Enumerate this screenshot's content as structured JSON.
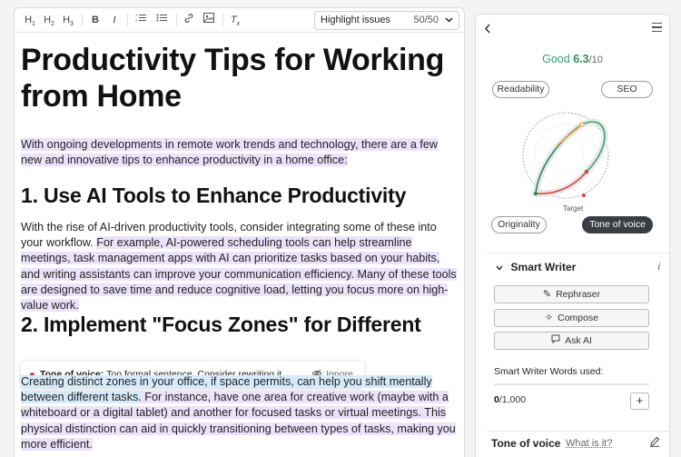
{
  "toolbar": {
    "h1": "H1",
    "h2": "H2",
    "h3": "H3",
    "bold": "B",
    "italic": "I",
    "highlight_label": "Highlight issues",
    "highlight_count": "50/50"
  },
  "document": {
    "title": "Productivity Tips for Working from Home",
    "intro": "With ongoing developments in remote work trends and technology, there are a few new and innovative tips to enhance productivity in a home office:",
    "section1_heading": "1. Use AI Tools to Enhance Productivity",
    "section1_p1": "With the rise of AI-driven productivity tools, consider integrating some of these into your workflow.",
    "section1_p2": "For example, AI-powered scheduling tools can help streamline meetings, task management apps with AI can prioritize tasks based on your habits, and writing assistants can improve your communication efficiency. Many of these tools are designed to save time and reduce cognitive load, letting you focus more on high-value work.",
    "section2_heading": "2. Implement \"Focus Zones\" for Different",
    "section2_p1": "Creating distinct zones in your office, if space permits, can help you shift mentally between different tasks.",
    "section2_p2": " For instance, have one area for creative work (maybe with a whiteboard or a digital tablet) and another for focused tasks or virtual meetings. This physical distinction can aid in quickly transitioning between types of tasks, making you more efficient."
  },
  "tone_popup": {
    "label": "Tone of voice:",
    "message": " Too formal sentence. Consider rewriting it.",
    "ignore": "Ignore"
  },
  "sidebar": {
    "score_word": "Good",
    "score_value": "6.3",
    "score_max": "/10",
    "pills": {
      "readability": "Readability",
      "seo": "SEO",
      "originality": "Originality",
      "tone": "Tone of voice"
    },
    "target_label": "Target",
    "smart_writer": {
      "title": "Smart Writer",
      "info": "i",
      "rephraser": "Rephraser",
      "compose": "Compose",
      "ask_ai": "Ask AI",
      "words_label": "Smart Writer Words used:",
      "words_used": "0",
      "words_limit": "/1,000",
      "plus": "+"
    },
    "tone_section": {
      "title": "Tone of voice",
      "what": "What is it?"
    }
  },
  "colors": {
    "accent_green": "#34a36a",
    "highlight_purple": "#ece3fb",
    "highlight_blue": "#d6eafc",
    "warning_red": "#d83b3b"
  }
}
